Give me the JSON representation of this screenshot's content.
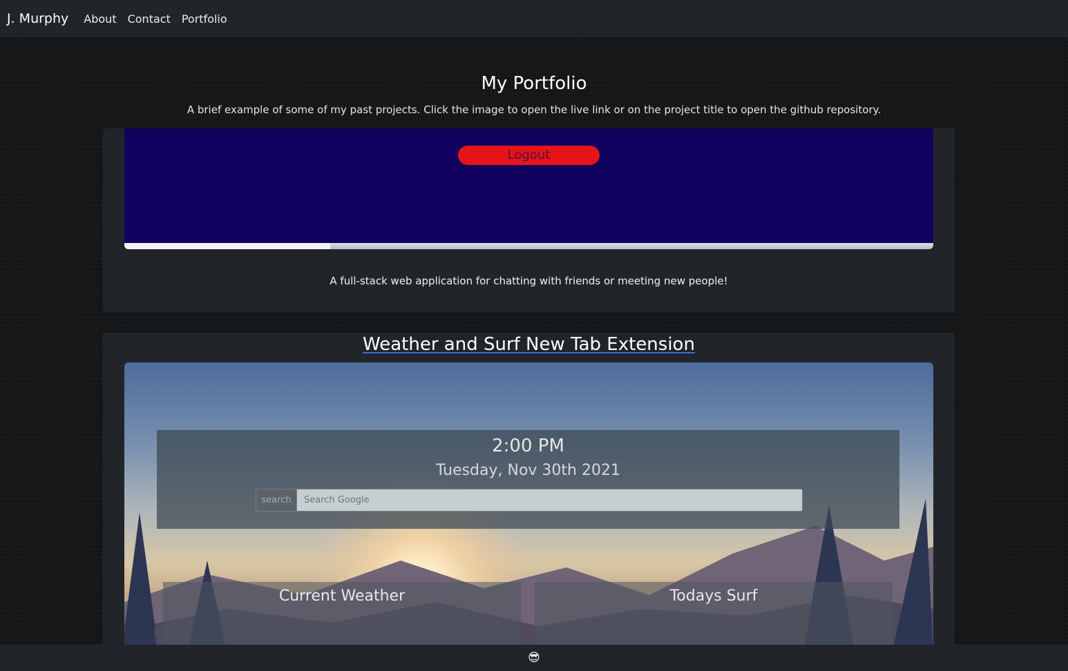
{
  "nav": {
    "brand": "J. Murphy",
    "links": [
      "About",
      "Contact",
      "Portfolio"
    ]
  },
  "header": {
    "title": "My Portfolio",
    "subtitle": "A brief example of some of my past projects. Click the image to open the live link or on the project title to open the github repository."
  },
  "projects": [
    {
      "screenshot": {
        "logout_label": "Logout"
      },
      "description": "A full-stack web application for chatting with friends or meeting new people!"
    },
    {
      "title": "Weather and Surf New Tab Extension",
      "screenshot": {
        "time": "2:00 PM",
        "date": "Tuesday, Nov 30th 2021",
        "search_button": "search",
        "search_placeholder": "Search Google",
        "weather_title": "Current Weather",
        "surf_title": "Todays Surf"
      }
    }
  ],
  "footer": {
    "icon": "sunglasses-emoji-icon",
    "glyph": "😎"
  }
}
